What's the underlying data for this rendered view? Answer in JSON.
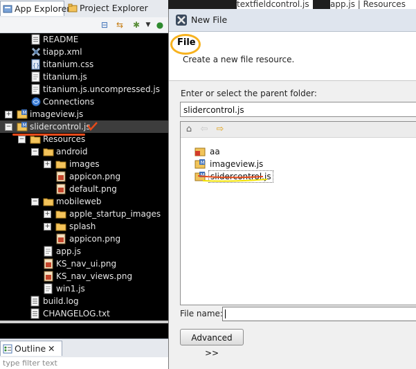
{
  "left_panel": {
    "tabs": [
      {
        "label": "App Explorer",
        "icon": "app-explorer-icon"
      },
      {
        "label": "Project Explorer",
        "icon": "project-explorer-icon"
      }
    ],
    "toolbar_icons": [
      "collapse-all-icon",
      "link-editor-icon",
      "new-item-icon",
      "run-icon"
    ],
    "tree": [
      {
        "label": "README",
        "icon": "text-file-icon",
        "depth": 2
      },
      {
        "label": "tiapp.xml",
        "icon": "xml-file-icon",
        "depth": 2
      },
      {
        "label": "titanium.css",
        "icon": "css-file-icon",
        "depth": 2
      },
      {
        "label": "titanium.js",
        "icon": "js-file-icon",
        "depth": 2
      },
      {
        "label": "titanium.js.uncompressed.js",
        "icon": "js-file-icon",
        "depth": 2
      },
      {
        "label": "Connections",
        "icon": "connections-icon",
        "depth": 2
      },
      {
        "label": "imageview.js",
        "icon": "mobile-project-icon",
        "depth": 0
      },
      {
        "label": "slidercontrol.js",
        "icon": "mobile-project-icon",
        "depth": 0
      },
      {
        "label": "Resources",
        "icon": "folder-icon",
        "depth": 1
      },
      {
        "label": "android",
        "icon": "folder-icon",
        "depth": 2
      },
      {
        "label": "images",
        "icon": "folder-icon",
        "depth": 3
      },
      {
        "label": "appicon.png",
        "icon": "image-file-icon",
        "depth": 4
      },
      {
        "label": "default.png",
        "icon": "image-file-icon",
        "depth": 4
      },
      {
        "label": "mobileweb",
        "icon": "folder-icon",
        "depth": 2
      },
      {
        "label": "apple_startup_images",
        "icon": "folder-icon",
        "depth": 3
      },
      {
        "label": "splash",
        "icon": "folder-icon",
        "depth": 3
      },
      {
        "label": "appicon.png",
        "icon": "image-file-icon",
        "depth": 4
      },
      {
        "label": "app.js",
        "icon": "js-file-icon",
        "depth": 2
      },
      {
        "label": "KS_nav_ui.png",
        "icon": "image-file-icon",
        "depth": 2
      },
      {
        "label": "KS_nav_views.png",
        "icon": "image-file-icon",
        "depth": 2
      },
      {
        "label": "win1.js",
        "icon": "js-file-icon",
        "depth": 2
      },
      {
        "label": "build.log",
        "icon": "text-file-icon",
        "depth": 1
      },
      {
        "label": "CHANGELOG.txt",
        "icon": "text-file-icon",
        "depth": 1
      }
    ],
    "outline_tab": "Outline",
    "outline_filter_placeholder": "type filter text"
  },
  "editor_tabs": [
    "textfieldcontrol.js",
    "app.js | Resources"
  ],
  "dialog": {
    "title": "New File",
    "header_title": "File",
    "header_description": "Create a new file resource.",
    "parent_label": "Enter or select the parent folder:",
    "parent_value": "slidercontrol.js",
    "nav_icons": [
      "home-icon",
      "back-arrow-icon",
      "forward-arrow-icon"
    ],
    "folders": [
      {
        "label": "aa",
        "icon": "project-icon"
      },
      {
        "label": "imageview.js",
        "icon": "mobile-project-icon"
      },
      {
        "label": "slidercontrol.js",
        "icon": "mobile-project-icon"
      }
    ],
    "filename_label": "File name:",
    "filename_value": "",
    "advanced_button": "Advanced >>"
  },
  "colors": {
    "panel_bg": "#000000",
    "selection_row": "#3d3d3d",
    "annotation_orange": "#f7b21f",
    "annotation_red": "#e64a1a",
    "annotation_yellow": "#f2e200"
  }
}
